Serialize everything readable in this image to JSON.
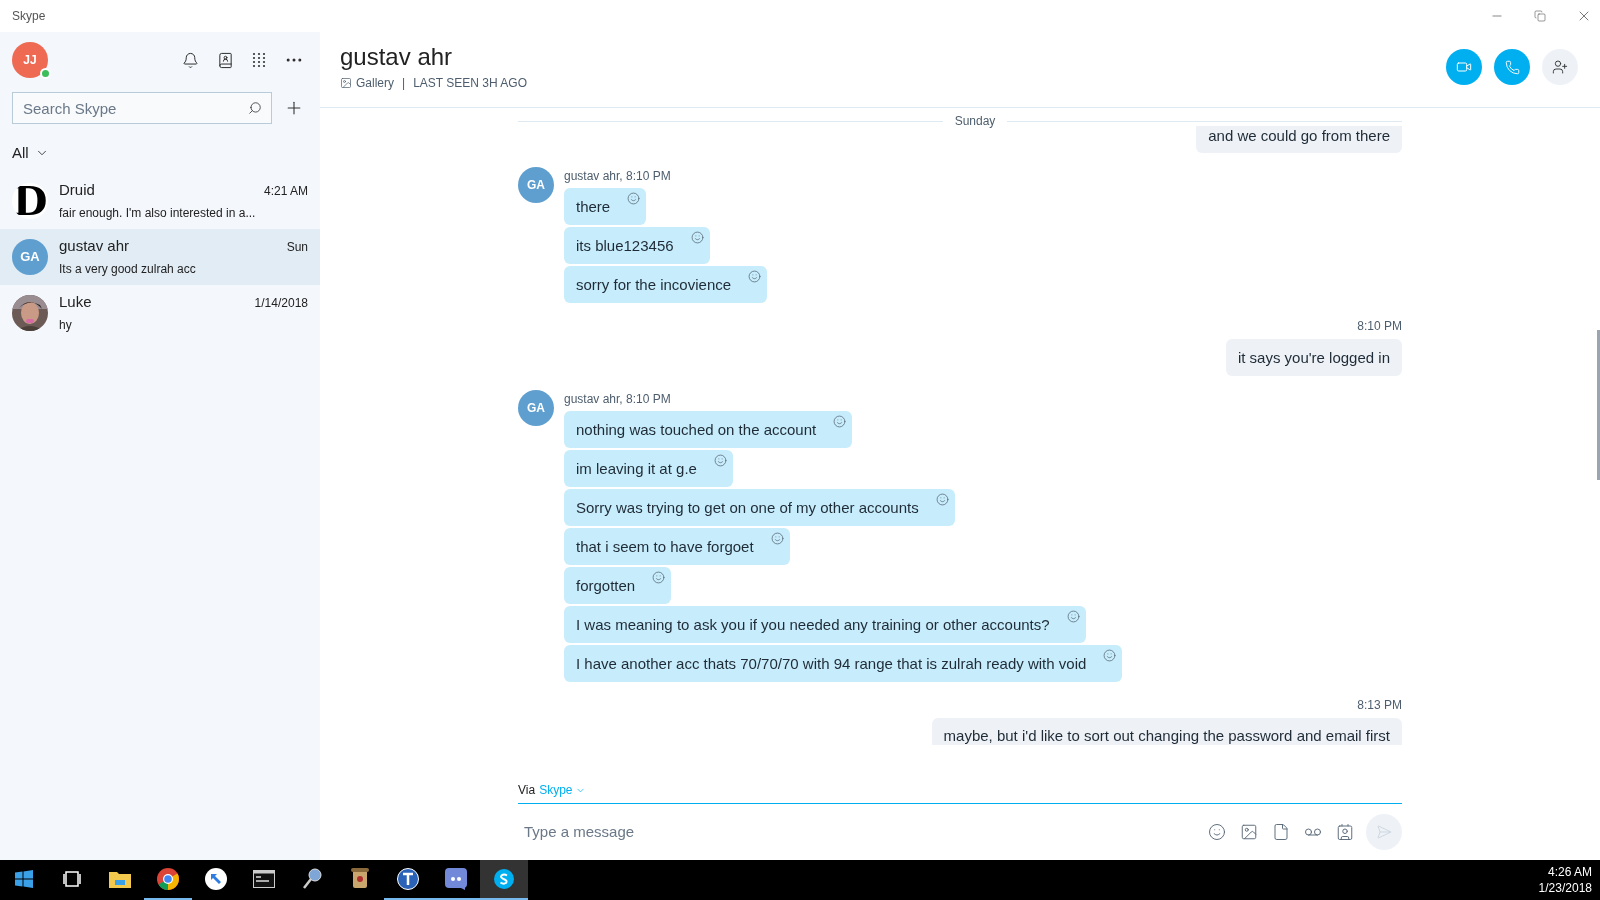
{
  "window": {
    "title": "Skype"
  },
  "sidebar": {
    "profile": {
      "initials": "JJ",
      "online": true
    },
    "search": {
      "placeholder": "Search Skype"
    },
    "filter": "All",
    "conversations": [
      {
        "name": "Druid",
        "preview": "fair enough. I'm also interested in a...",
        "time": "4:21 AM",
        "avatar": {
          "kind": "letter",
          "text": "D"
        },
        "selected": false
      },
      {
        "name": "gustav ahr",
        "preview": "Its a very good zulrah acc",
        "time": "Sun",
        "avatar": {
          "kind": "initials",
          "text": "GA"
        },
        "selected": true
      },
      {
        "name": "Luke",
        "preview": "hy",
        "time": "1/14/2018",
        "selected": false
      }
    ]
  },
  "chat": {
    "title": "gustav ahr",
    "gallery": "Gallery",
    "separator": "|",
    "last_seen": "LAST SEEN 3H AGO",
    "day": "Sunday",
    "messages": [
      {
        "kind": "outgoing",
        "bubbles": [
          "and we could go from there"
        ]
      },
      {
        "kind": "incoming",
        "avatar": "GA",
        "header": "gustav ahr, 8:10 PM",
        "bubbles": [
          "there",
          "its blue123456",
          "sorry for the incovience"
        ]
      },
      {
        "kind": "outgoing",
        "time": "8:10 PM",
        "bubbles": [
          "it says you're logged in"
        ]
      },
      {
        "kind": "incoming",
        "avatar": "GA",
        "header": "gustav ahr, 8:10 PM",
        "bubbles": [
          "nothing was touched on the account",
          "im leaving it at g.e",
          "Sorry was trying to get on one of my other accounts",
          "that i seem to have forgoet",
          "forgotten",
          "I was meaning to ask you if you needed any training or other accounts?",
          "I have another acc thats 70/70/70 with 94 range that is zulrah ready with void"
        ]
      },
      {
        "kind": "outgoing",
        "time": "8:13 PM",
        "bubbles": [
          "maybe, but i'd like to sort out changing the password and email first"
        ]
      }
    ]
  },
  "composer": {
    "via": "Via",
    "service": "Skype",
    "placeholder": "Type a message"
  },
  "taskbar": {
    "apps": [
      {
        "kind": "start",
        "running": false,
        "selected": false
      },
      {
        "kind": "taskview",
        "running": false,
        "selected": false
      },
      {
        "kind": "folder",
        "running": false,
        "selected": false
      },
      {
        "kind": "chrome",
        "running": true,
        "selected": false
      },
      {
        "kind": "arrow",
        "running": false,
        "selected": false
      },
      {
        "kind": "terminal",
        "running": false,
        "selected": false
      },
      {
        "kind": "magnifier",
        "running": false,
        "selected": false
      },
      {
        "kind": "scroll",
        "running": false,
        "selected": false
      },
      {
        "kind": "tcircle",
        "running": true,
        "selected": false
      },
      {
        "kind": "discord",
        "running": true,
        "selected": false
      },
      {
        "kind": "skype",
        "running": true,
        "selected": true
      }
    ],
    "time": "4:26 AM",
    "date": "1/23/2018"
  }
}
